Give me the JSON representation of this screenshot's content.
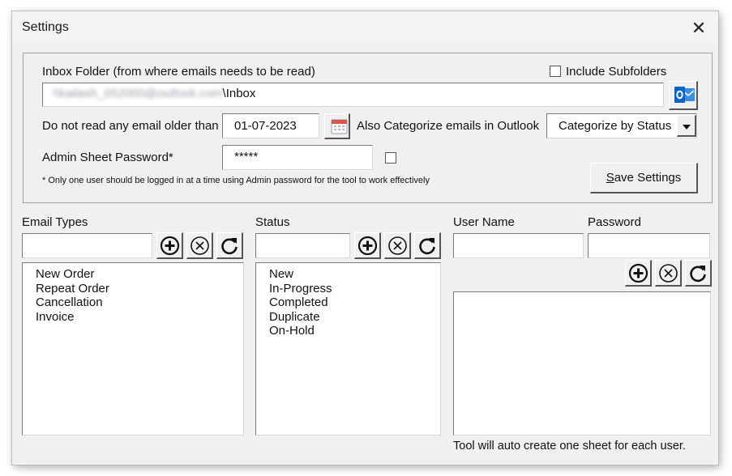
{
  "window": {
    "title": "Settings",
    "close_glyph": "✕"
  },
  "inbox": {
    "label": "Inbox Folder (from where emails needs to be read)",
    "include_subfolders_label": "Include Subfolders",
    "path_blurred": "\\\\kailash_052000@outlook.com",
    "path_suffix": "\\Inbox",
    "outlook_icon": "outlook-icon"
  },
  "date_filter": {
    "label": "Do not read any email older than",
    "value": "01-07-2023",
    "calendar_icon": "calendar-icon"
  },
  "categorize": {
    "label": "Also Categorize emails in Outlook",
    "selected": "Categorize by Status"
  },
  "admin": {
    "label": "Admin Sheet Password*",
    "value": "*****",
    "note": "* Only one user should be logged in at a time using Admin password for the tool to work effectively"
  },
  "save_button": {
    "prefix": "",
    "underlined": "S",
    "rest": "ave Settings"
  },
  "email_types": {
    "label": "Email Types",
    "input_value": "",
    "items": [
      "New Order",
      "Repeat Order",
      "Cancellation",
      "Invoice"
    ]
  },
  "status": {
    "label": "Status",
    "input_value": "",
    "items": [
      "New",
      "In-Progress",
      "Completed",
      "Duplicate",
      "On-Hold"
    ]
  },
  "users": {
    "user_name_label": "User Name",
    "password_label": "Password",
    "user_input_value": "",
    "password_input_value": "",
    "note": "Tool will auto create one sheet for each user."
  },
  "icons": {
    "add": "add-circle-icon",
    "remove": "remove-circle-icon",
    "refresh": "refresh-icon"
  },
  "colors": {
    "outlook_blue": "#0a64c8",
    "calendar_red": "#d9534f",
    "dialog_bg": "#f0f0f0"
  }
}
